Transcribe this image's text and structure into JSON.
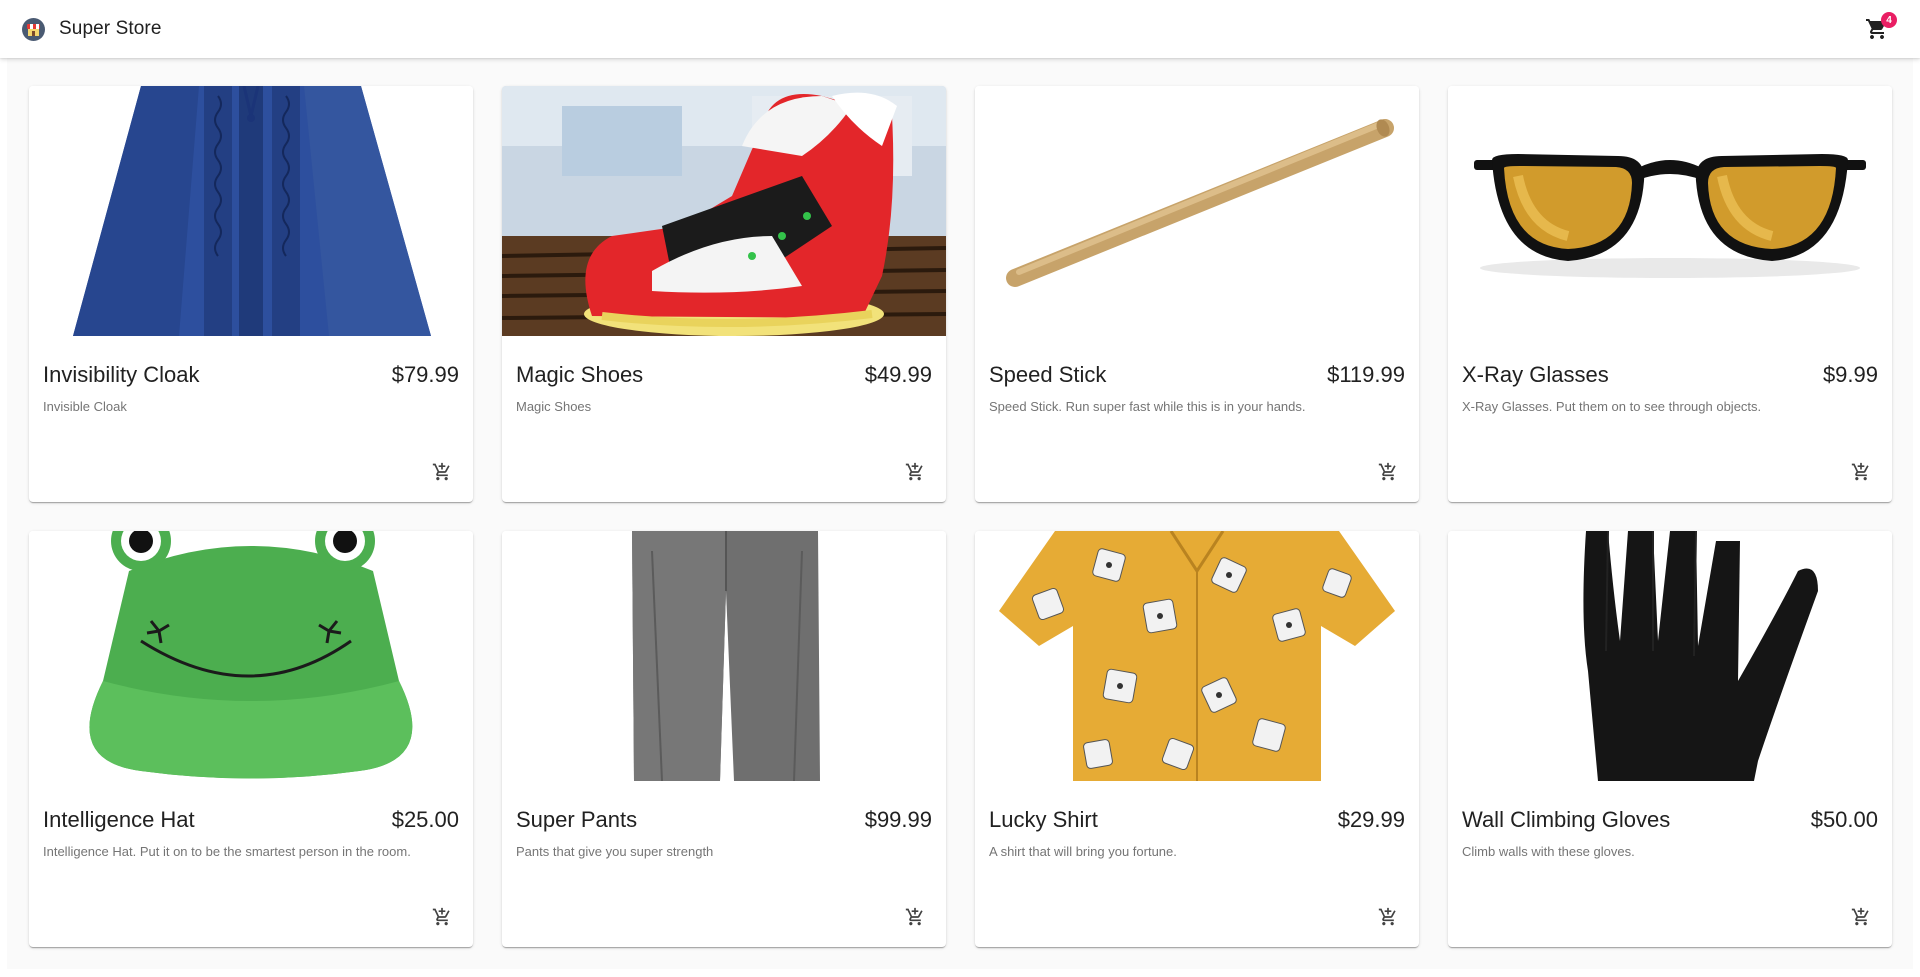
{
  "app": {
    "title": "Super Store",
    "cart_count": "4",
    "accent_color": "#e91e63"
  },
  "products": [
    {
      "name": "Invisibility Cloak",
      "price": "$79.99",
      "description": "Invisible Cloak",
      "icon": "cloak-image"
    },
    {
      "name": "Magic Shoes",
      "price": "$49.99",
      "description": "Magic Shoes",
      "icon": "shoe-image"
    },
    {
      "name": "Speed Stick",
      "price": "$119.99",
      "description": "Speed Stick. Run super fast while this is in your hands.",
      "icon": "stick-image"
    },
    {
      "name": "X-Ray Glasses",
      "price": "$9.99",
      "description": "X-Ray Glasses. Put them on to see through objects.",
      "icon": "glasses-image"
    },
    {
      "name": "Intelligence Hat",
      "price": "$25.00",
      "description": "Intelligence Hat. Put it on to be the smartest person in the room.",
      "icon": "frog-hat-image"
    },
    {
      "name": "Super Pants",
      "price": "$99.99",
      "description": "Pants that give you super strength",
      "icon": "pants-image"
    },
    {
      "name": "Lucky Shirt",
      "price": "$29.99",
      "description": "A shirt that will bring you fortune.",
      "icon": "dice-shirt-image"
    },
    {
      "name": "Wall Climbing Gloves",
      "price": "$50.00",
      "description": "Climb walls with these gloves.",
      "icon": "glove-image"
    }
  ]
}
